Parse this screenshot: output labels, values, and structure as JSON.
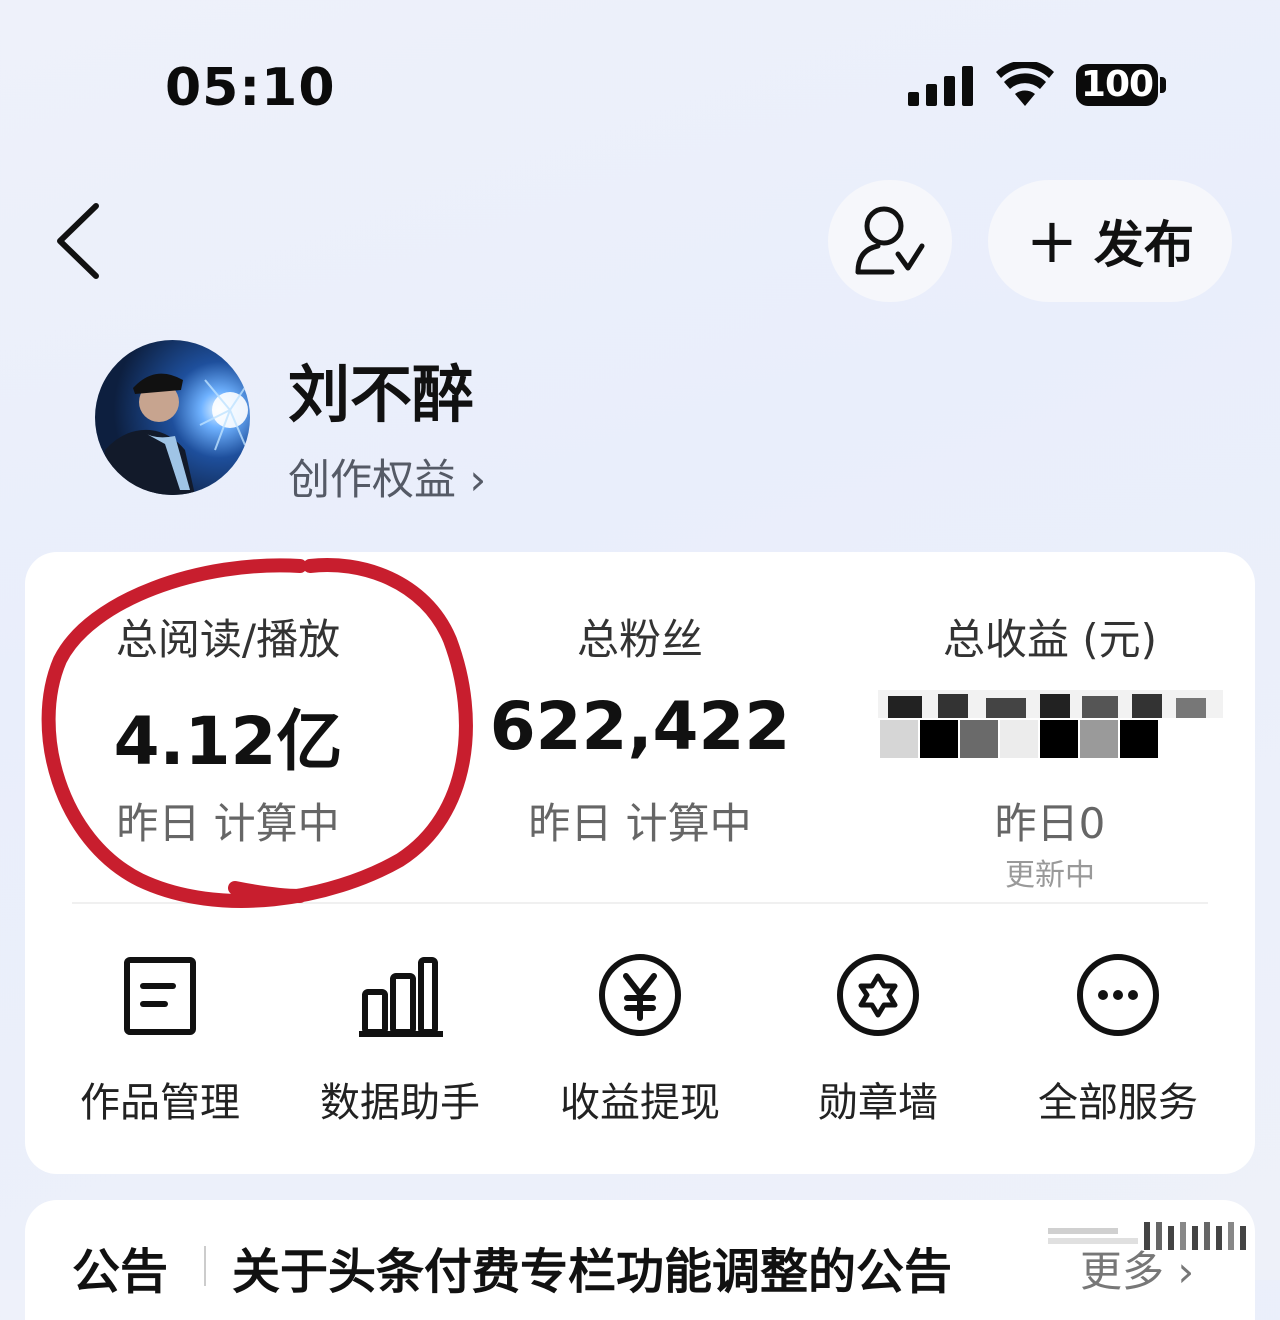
{
  "status_bar": {
    "time": "05:10",
    "battery": "100"
  },
  "header": {
    "publish_label": "发布",
    "publish_plus": "+"
  },
  "profile": {
    "name": "刘不醉",
    "rights_link": "创作权益 ›"
  },
  "stats": [
    {
      "label": "总阅读/播放",
      "value": "4.12亿",
      "sub": "昨日 计算中"
    },
    {
      "label": "总粉丝",
      "value": "622,422",
      "sub": "昨日 计算中"
    },
    {
      "label": "总收益 (元)",
      "value": "",
      "sub": "昨日0",
      "sub_note": "更新中"
    }
  ],
  "services": [
    {
      "label": "作品管理",
      "icon": "document-icon"
    },
    {
      "label": "数据助手",
      "icon": "bar-chart-icon"
    },
    {
      "label": "收益提现",
      "icon": "yen-icon"
    },
    {
      "label": "勋章墙",
      "icon": "medal-icon"
    },
    {
      "label": "全部服务",
      "icon": "more-icon"
    }
  ],
  "notice": {
    "tag": "公告",
    "text": "关于头条付费专栏功能调整的公告",
    "more": "更多 ›"
  },
  "colors": {
    "annotation": "#c81e2e",
    "card": "#ffffff",
    "background": "#eef1fa"
  }
}
